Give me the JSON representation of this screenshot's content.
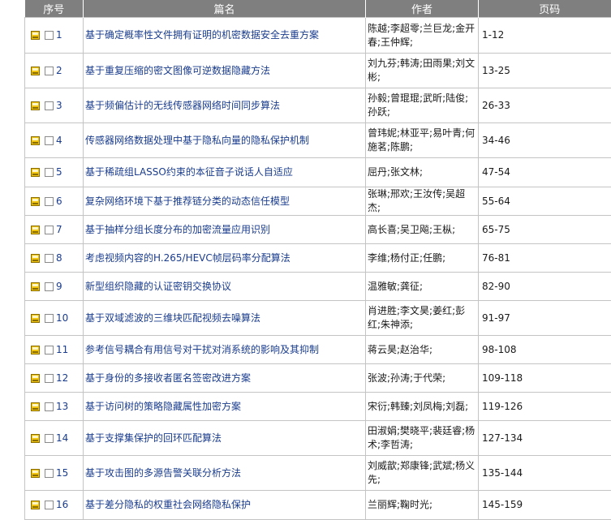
{
  "header": {
    "col_index": "序号",
    "col_title": "篇名",
    "col_authors": "作者",
    "col_pages": "页码"
  },
  "rows": [
    {
      "no": "1",
      "title": "基于确定概率性文件拥有证明的机密数据安全去重方案",
      "authors": "陈越;李超零;兰巨龙;金开春;王仲辉;",
      "pages": "1-12"
    },
    {
      "no": "2",
      "title": "基于重复压缩的密文图像可逆数据隐藏方法",
      "authors": "刘九芬;韩涛;田雨果;刘文彬;",
      "pages": "13-25"
    },
    {
      "no": "3",
      "title": "基于频偏估计的无线传感器网络时间同步算法",
      "authors": "孙毅;曾琨琨;武昕;陆俊;孙跃;",
      "pages": "26-33"
    },
    {
      "no": "4",
      "title": "传感器网络数据处理中基于隐私向量的隐私保护机制",
      "authors": "曾玮妮;林亚平;易叶青;何施茗;陈鹏;",
      "pages": "34-46"
    },
    {
      "no": "5",
      "title": "基于稀疏组LASSO约束的本征音子说话人自适应",
      "authors": "屈丹;张文林;",
      "pages": "47-54"
    },
    {
      "no": "6",
      "title": "复杂网络环境下基于推荐链分类的动态信任模型",
      "authors": "张琳;邢欢;王汝传;吴超杰;",
      "pages": "55-64"
    },
    {
      "no": "7",
      "title": "基于抽样分组长度分布的加密流量应用识别",
      "authors": "高长喜;吴卫飚;王枞;",
      "pages": "65-75"
    },
    {
      "no": "8",
      "title": "考虑视频内容的H.265/HEVC帧层码率分配算法",
      "authors": "李维;杨付正;任鹏;",
      "pages": "76-81"
    },
    {
      "no": "9",
      "title": "新型组织隐藏的认证密钥交换协议",
      "authors": "温雅敏;龚征;",
      "pages": "82-90"
    },
    {
      "no": "10",
      "title": "基于双域滤波的三维块匹配视频去噪算法",
      "authors": "肖进胜;李文昊;姜红;彭红;朱神添;",
      "pages": "91-97"
    },
    {
      "no": "11",
      "title": "参考信号耦合有用信号对干扰对消系统的影响及其抑制",
      "authors": "蒋云昊;赵治华;",
      "pages": "98-108"
    },
    {
      "no": "12",
      "title": "基于身份的多接收者匿名签密改进方案",
      "authors": "张波;孙涛;于代荣;",
      "pages": "109-118"
    },
    {
      "no": "13",
      "title": "基于访问树的策略隐藏属性加密方案",
      "authors": "宋衍;韩臻;刘凤梅;刘磊;",
      "pages": "119-126"
    },
    {
      "no": "14",
      "title": "基于支撑集保护的回环匹配算法",
      "authors": "田淑娟;樊晓平;裴廷睿;杨术;李哲涛;",
      "pages": "127-134"
    },
    {
      "no": "15",
      "title": "基于攻击图的多源告警关联分析方法",
      "authors": "刘威歆;郑康锋;武斌;杨义先;",
      "pages": "135-144"
    },
    {
      "no": "16",
      "title": "基于差分隐私的权重社会网络隐私保护",
      "authors": "兰丽辉;鞠时光;",
      "pages": "145-159"
    }
  ]
}
